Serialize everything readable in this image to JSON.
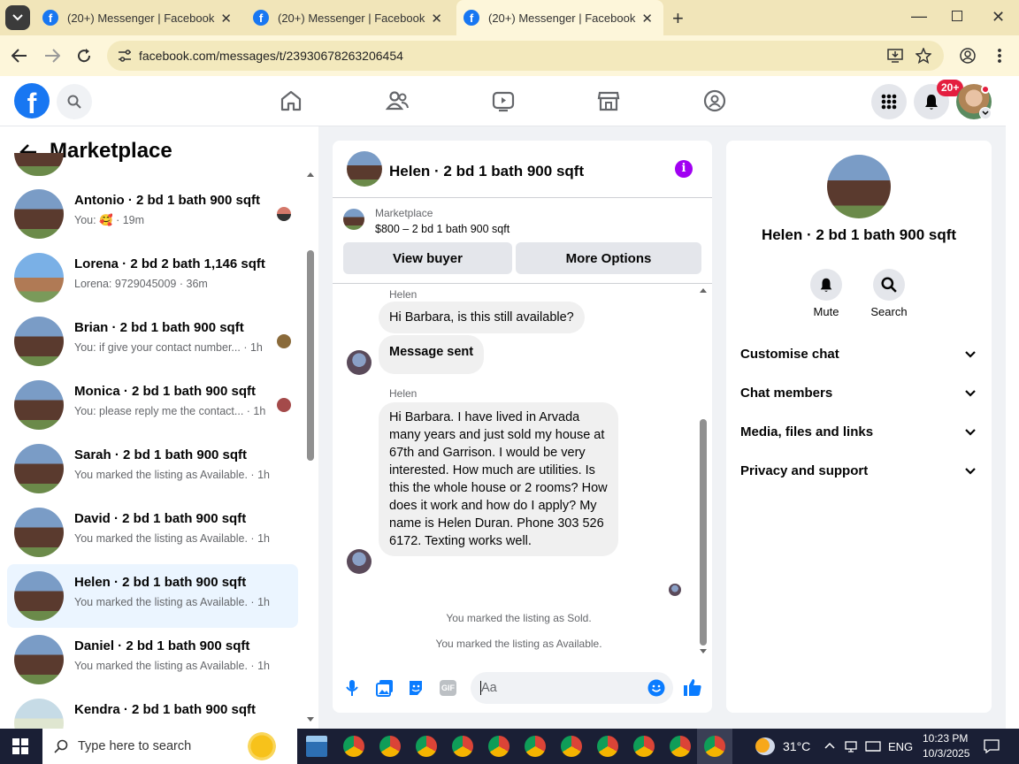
{
  "browser": {
    "tabs": [
      {
        "title": "(20+) Messenger | Facebook"
      },
      {
        "title": "(20+) Messenger | Facebook"
      },
      {
        "title": "(20+) Messenger | Facebook"
      }
    ],
    "url": "facebook.com/messages/t/23930678263206454"
  },
  "header": {
    "notification_badge": "20+",
    "brand_color": "#1877f2"
  },
  "sidebar": {
    "title": "Marketplace",
    "conversations": [
      {
        "title": "Antonio · 2 bd 1 bath 900 sqft",
        "snippet": "You: 🥰 · 19m"
      },
      {
        "title": "Lorena · 2 bd 2 bath 1,146 sqft",
        "snippet": "Lorena: 9729045009 · 36m"
      },
      {
        "title": "Brian · 2 bd 1 bath 900 sqft",
        "snippet": "You: if give your contact number... · 1h"
      },
      {
        "title": "Monica · 2 bd 1 bath 900 sqft",
        "snippet": "You: please reply me the contact... · 1h"
      },
      {
        "title": "Sarah · 2 bd 1 bath 900 sqft",
        "snippet": "You marked the listing as Available. · 1h"
      },
      {
        "title": "David · 2 bd 1 bath 900 sqft",
        "snippet": "You marked the listing as Available. · 1h"
      },
      {
        "title": "Helen · 2 bd 1 bath 900 sqft",
        "snippet": "You marked the listing as Available. · 1h"
      },
      {
        "title": "Daniel · 2 bd 1 bath 900 sqft",
        "snippet": "You marked the listing as Available. · 1h"
      },
      {
        "title": "Kendra · 2 bd 1 bath 900 sqft",
        "snippet": ""
      }
    ]
  },
  "chat": {
    "title": "Helen · 2 bd 1 bath 900 sqft",
    "listing_source": "Marketplace",
    "listing_price": "$800 – 2 bd 1 bath 900 sqft",
    "view_buyer": "View buyer",
    "more_options": "More Options",
    "messages": [
      {
        "sender": "Helen",
        "text": "Hi Barbara, is this still available?"
      },
      {
        "text": "Message sent"
      },
      {
        "sender": "Helen",
        "text": "Hi Barbara.  I have lived in Arvada many years and just sold my house at 67th and Garrison.  I would be very interested.  How much are utilities.  Is this the whole house or 2 rooms?  How does it work and how do I apply?  My name is Helen Duran.  Phone 303 526 6172.  Texting works well."
      }
    ],
    "system_sold": "You marked the listing as Sold.",
    "system_available": "You marked the listing as Available.",
    "composer_placeholder": "Aa"
  },
  "info": {
    "title": "Helen · 2 bd 1 bath 900 sqft",
    "mute": "Mute",
    "search": "Search",
    "sections": [
      "Customise chat",
      "Chat members",
      "Media, files and links",
      "Privacy and support"
    ]
  },
  "taskbar": {
    "search_placeholder": "Type here to search",
    "temperature": "31°C",
    "language": "ENG",
    "time": "10:23 PM",
    "date": "10/3/2025"
  }
}
